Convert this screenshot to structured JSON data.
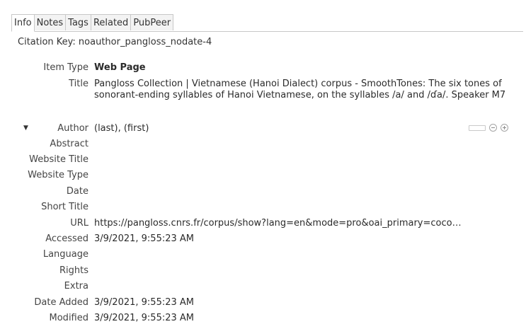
{
  "tabs": [
    "Info",
    "Notes",
    "Tags",
    "Related",
    "PubPeer"
  ],
  "citation_key": "Citation Key: noauthor_pangloss_nodate-4",
  "fields": {
    "item_type": {
      "label": "Item Type",
      "value": "Web Page"
    },
    "title": {
      "label": "Title",
      "value": "Pangloss Collection | Vietnamese (Hanoi Dialect) corpus - SmoothTones: The six tones of sonorant-ending syllables of Hanoi Vietnamese, on the syllables /a/ and /ɗa/. Speaker M7"
    },
    "author": {
      "label": "Author",
      "value": "(last), (first)"
    },
    "abstract": {
      "label": "Abstract",
      "value": ""
    },
    "website_title": {
      "label": "Website Title",
      "value": ""
    },
    "website_type": {
      "label": "Website Type",
      "value": ""
    },
    "date": {
      "label": "Date",
      "value": ""
    },
    "short_title": {
      "label": "Short Title",
      "value": ""
    },
    "url": {
      "label": "URL",
      "value": "https://pangloss.cnrs.fr/corpus/show?lang=en&mode=pro&oai_primary=coco…"
    },
    "accessed": {
      "label": "Accessed",
      "value": "3/9/2021, 9:55:23 AM"
    },
    "language": {
      "label": "Language",
      "value": ""
    },
    "rights": {
      "label": "Rights",
      "value": ""
    },
    "extra": {
      "label": "Extra",
      "value": ""
    },
    "date_added": {
      "label": "Date Added",
      "value": "3/9/2021, 9:55:23 AM"
    },
    "modified": {
      "label": "Modified",
      "value": "3/9/2021, 9:55:23 AM"
    }
  },
  "icons": {
    "twisty": "triangle-down-icon",
    "author_mode": "field-mode-toggle-icon",
    "remove": "minus-circle-icon",
    "add": "plus-circle-icon"
  }
}
